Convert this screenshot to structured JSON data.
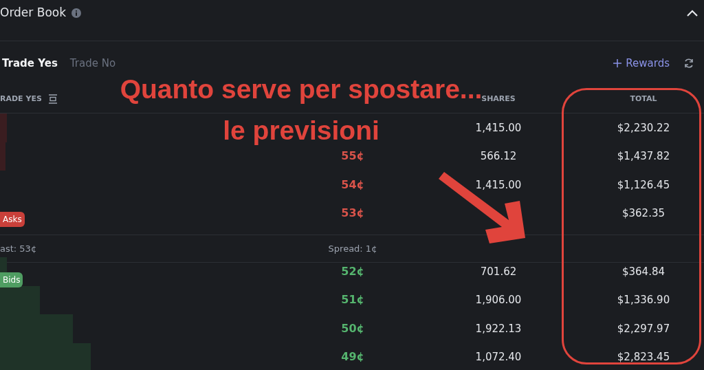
{
  "header": {
    "title": "Order Book",
    "expanded": true
  },
  "tabs": [
    {
      "label": "Trade Yes",
      "selected": true
    },
    {
      "label": "Trade No",
      "selected": false
    }
  ],
  "rewards": "Rewards",
  "columns": {
    "outcome": "RADE YES",
    "shares": "SHARES",
    "total": "TOTAL"
  },
  "asks": {
    "badge": "Asks",
    "rows": [
      {
        "shares": "1,415.00",
        "total": "$2,230.22"
      },
      {
        "price": "55¢",
        "shares": "566.12",
        "total": "$1,437.82"
      },
      {
        "price": "54¢",
        "shares": "1,415.00",
        "total": "$1,126.45"
      },
      {
        "price": "53¢",
        "total": "$362.35"
      }
    ]
  },
  "last": "ast: 53¢",
  "spread": "Spread: 1¢",
  "bids": {
    "badge": "Bids",
    "rows": [
      {
        "price": "52¢",
        "shares": "701.62",
        "total": "$364.84"
      },
      {
        "price": "51¢",
        "shares": "1,906.00",
        "total": "$1,336.90"
      },
      {
        "price": "50¢",
        "shares": "1,922.13",
        "total": "$2,297.97"
      },
      {
        "price": "49¢",
        "shares": "1,072.40",
        "total": "$2,823.45"
      }
    ]
  },
  "annotation": {
    "lines": [
      "Quanto serve per spostare...",
      "le previsioni"
    ]
  }
}
